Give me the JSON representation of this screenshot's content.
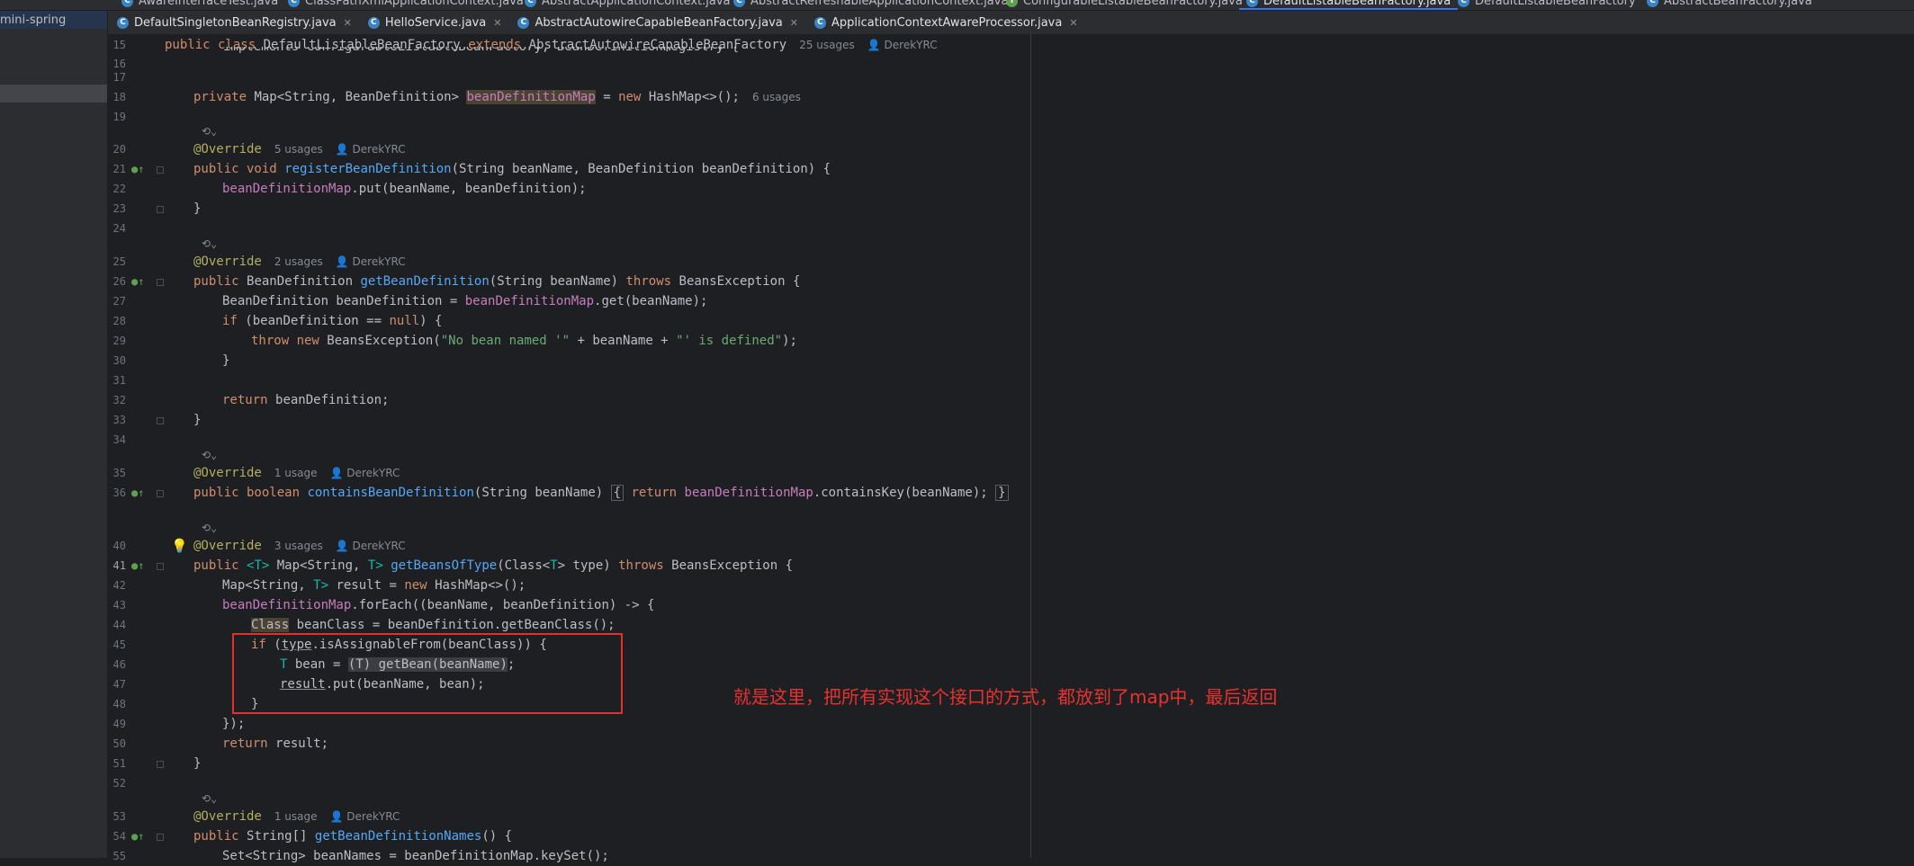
{
  "top_tabs": [
    {
      "label": "AwareInterfaceTest.java"
    },
    {
      "label": "ClassPathXmlApplicationContext.java"
    },
    {
      "label": "AbstractApplicationContext.java"
    },
    {
      "label": "AbstractRefreshableApplicationContext.java"
    },
    {
      "label": "ConfigurableListableBeanFactory.java"
    },
    {
      "label": "DefaultListableBeanFactory.java"
    },
    {
      "label": "DefaultListableBeanFactory"
    },
    {
      "label": "AbstractBeanFactory.java"
    }
  ],
  "tabs": [
    {
      "label": "DefaultSingletonBeanRegistry.java"
    },
    {
      "label": "HelloService.java"
    },
    {
      "label": "AbstractAutowireCapableBeanFactory.java"
    },
    {
      "label": "ApplicationContextAwareProcessor.java"
    }
  ],
  "project": {
    "label": "mini-spring"
  },
  "lines": {
    "l15": "15",
    "l16": "16",
    "l17": "17",
    "l18": "18",
    "l19": "19",
    "l20": "20",
    "l21": "21",
    "l22": "22",
    "l23": "23",
    "l24": "24",
    "l25": "25",
    "l26": "26",
    "l27": "27",
    "l28": "28",
    "l29": "29",
    "l30": "30",
    "l31": "31",
    "l32": "32",
    "l33": "33",
    "l34": "34",
    "l35": "35",
    "l36": "36",
    "l40": "40",
    "l41": "41",
    "l42": "42",
    "l43": "43",
    "l44": "44",
    "l45": "45",
    "l46": "46",
    "l47": "47",
    "l48": "48",
    "l49": "49",
    "l50": "50",
    "l51": "51",
    "l52": "52",
    "l53": "53",
    "l54": "54",
    "l55": "55"
  },
  "code": {
    "decl_public_class": "public class",
    "decl_name": "DefaultListableBeanFactory",
    "decl_extends": "extends",
    "decl_super": "AbstractAutowireCapableBeanFactory",
    "decl_hint_usages": "25 usages",
    "decl_hint_author": "DerekYRC",
    "implements_line": "implements ConfigurableListableBeanFactory, BeanDefinitionRegistry {",
    "map_private": "private",
    "map_type": "Map<String, BeanDefinition>",
    "map_field": "beanDefinitionMap",
    "map_eq": "=",
    "map_new": "new",
    "map_rest": "HashMap<>();",
    "map_hint": "6 usages",
    "override": "@Override",
    "u5": "5 usages",
    "u2": "2 usages",
    "u1": "1 usage",
    "u3": "3 usages",
    "author": "DerekYRC",
    "pub_void": "public void",
    "register_name": "registerBeanDefinition",
    "register_params": "(String beanName, BeanDefinition beanDefinition) {",
    "put_field": "beanDefinitionMap",
    "put_rest": ".put(beanName, beanDefinition);",
    "close_brace": "}",
    "pub": "public",
    "bd_type": "BeanDefinition",
    "getbd_name": "getBeanDefinition",
    "getbd_params": "(String beanName)",
    "throws": "throws",
    "beans_ex": "BeansException {",
    "bd_local": "BeanDefinition beanDefinition =",
    "get_rest": ".get(beanName);",
    "if_kw": "if",
    "if_null_a": "(beanDefinition ==",
    "null_kw": "null",
    "if_null_b": ") {",
    "throw_new": "throw new",
    "beans_ex_call": "BeansException(",
    "ex_str1": "\"No bean named '\"",
    "ex_mid": "+ beanName +",
    "ex_str2": "\"' is defined\"",
    "ex_end": ");",
    "return_kw": "return",
    "return_bd": "beanDefinition;",
    "boolean_kw": "public boolean",
    "contains_name": "containsBeanDefinition",
    "contains_params": "(String beanName)",
    "contains_open": "{",
    "contains_field": "beanDefinitionMap",
    "contains_rest": ".containsKey(beanName);",
    "contains_close": "}",
    "generic_pub": "public",
    "generic_t": "<T>",
    "generic_map": "Map<String,",
    "generic_t2": "T>",
    "getbeans_name": "getBeansOfType",
    "getbeans_params_a": "(Class<",
    "getbeans_params_b": "T",
    "getbeans_params_c": "> type)",
    "result_decl": "Map<String,",
    "result_t": "T>",
    "result_rest_a": "result =",
    "result_rest_b": "HashMap<>();",
    "foreach_field": "beanDefinitionMap",
    "foreach_rest": ".forEach((beanName, beanDefinition) -> {",
    "class_kw": "Class",
    "class_rest": "beanClass = beanDefinition.getBeanClass();",
    "if2_a": "(",
    "if2_type": "type",
    "if2_rest": ".isAssignableFrom(beanClass)) {",
    "bean_t": "T",
    "bean_rest": "bean =",
    "bean_cast": "(T) getBean(beanName)",
    "bean_end": ";",
    "result_field": "result",
    "result_put": ".put(beanName, bean);",
    "lambda_close": "});",
    "return_result": "result;",
    "str_arr_a": "public",
    "str_arr_b": "String[]",
    "names_name": "getBeanDefinitionNames",
    "names_rest": "() {",
    "last_line": "Set<String> beanNames = beanDefinitionMap.keySet();"
  },
  "annotation_note": "就是这里，把所有实现这个接口的方式，都放到了map中，最后返回",
  "colors": {
    "editor_bg": "#1e1f22",
    "keyword": "#cf8e6d",
    "annotation": "#b3ae60",
    "method": "#56a8f5",
    "field": "#c77dbb",
    "string": "#6aab73",
    "note": "#e8322f"
  }
}
